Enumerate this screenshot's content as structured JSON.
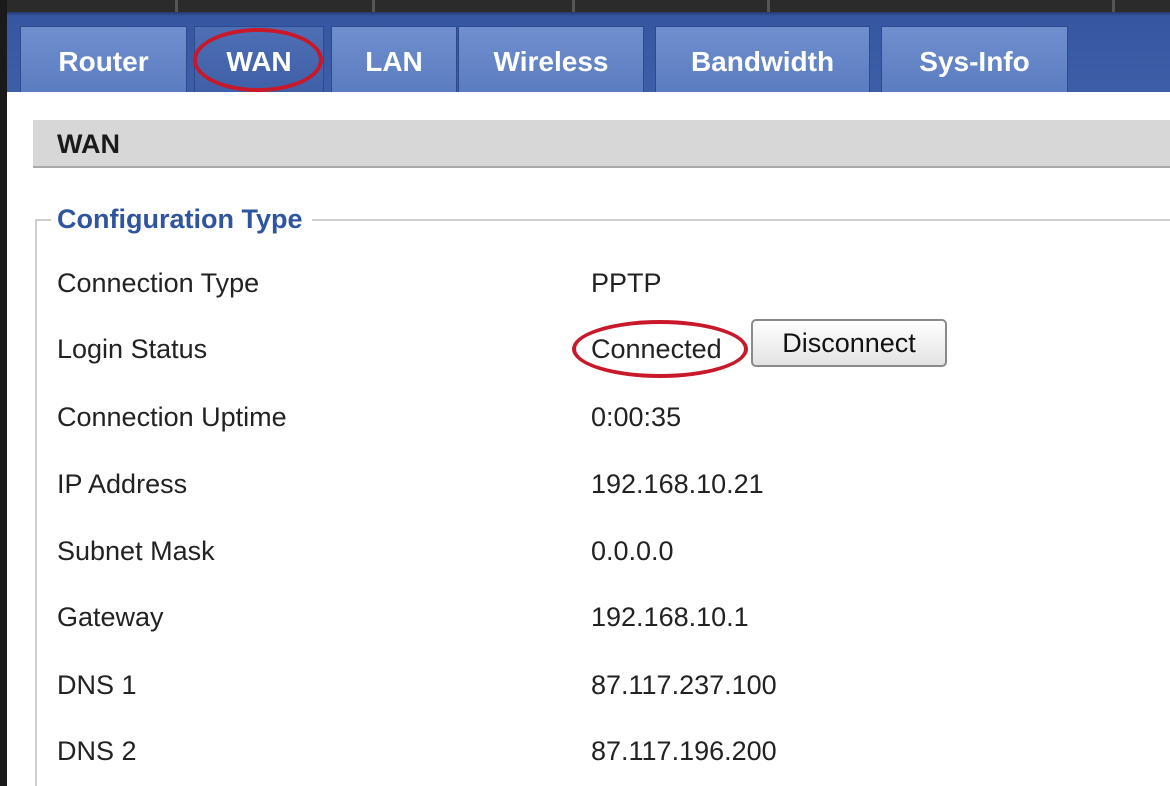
{
  "tabs": [
    {
      "label": "Router"
    },
    {
      "label": "WAN"
    },
    {
      "label": "LAN"
    },
    {
      "label": "Wireless"
    },
    {
      "label": "Bandwidth"
    },
    {
      "label": "Sys-Info"
    }
  ],
  "active_tab": "WAN",
  "section": {
    "title": "WAN",
    "legend": "Configuration Type"
  },
  "rows": {
    "connection_type": {
      "label": "Connection Type",
      "value": "PPTP"
    },
    "login_status": {
      "label": "Login Status",
      "value": "Connected",
      "button_label": "Disconnect"
    },
    "connection_uptime": {
      "label": "Connection Uptime",
      "value": "0:00:35"
    },
    "ip_address": {
      "label": "IP Address",
      "value": "192.168.10.21"
    },
    "subnet_mask": {
      "label": "Subnet Mask",
      "value": "0.0.0.0"
    },
    "gateway": {
      "label": "Gateway",
      "value": "192.168.10.1"
    },
    "dns1": {
      "label": "DNS 1",
      "value": "87.117.237.100"
    },
    "dns2": {
      "label": "DNS 2",
      "value": "87.117.196.200"
    }
  },
  "colors": {
    "tab_bar": "#3d5fa8",
    "tab": "#6f8fcf",
    "legend_text": "#2f55a0",
    "annotation_circle": "#c8182a",
    "section_header": "#d7d7d7"
  }
}
